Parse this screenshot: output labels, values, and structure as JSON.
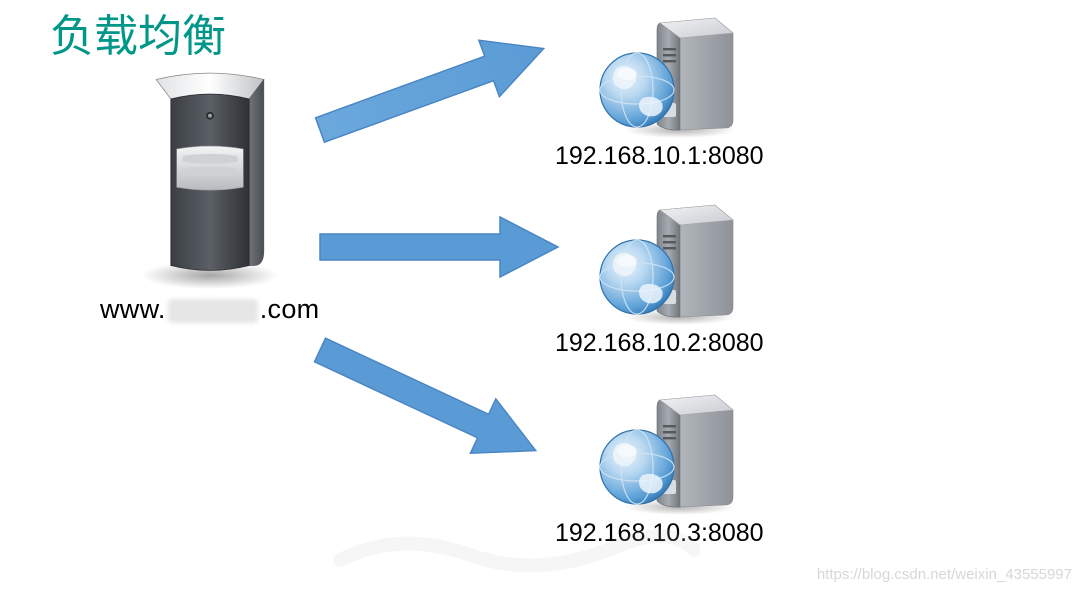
{
  "title": "负载均衡",
  "client": {
    "domain_prefix": "www.",
    "domain_suffix": ".com",
    "domain_middle_redacted": true
  },
  "servers": [
    {
      "address": "192.168.10.1:8080"
    },
    {
      "address": "192.168.10.2:8080"
    },
    {
      "address": "192.168.10.3:8080"
    }
  ],
  "arrow_color": "#5B9BD5",
  "watermark": "https://blog.csdn.net/weixin_43555997"
}
